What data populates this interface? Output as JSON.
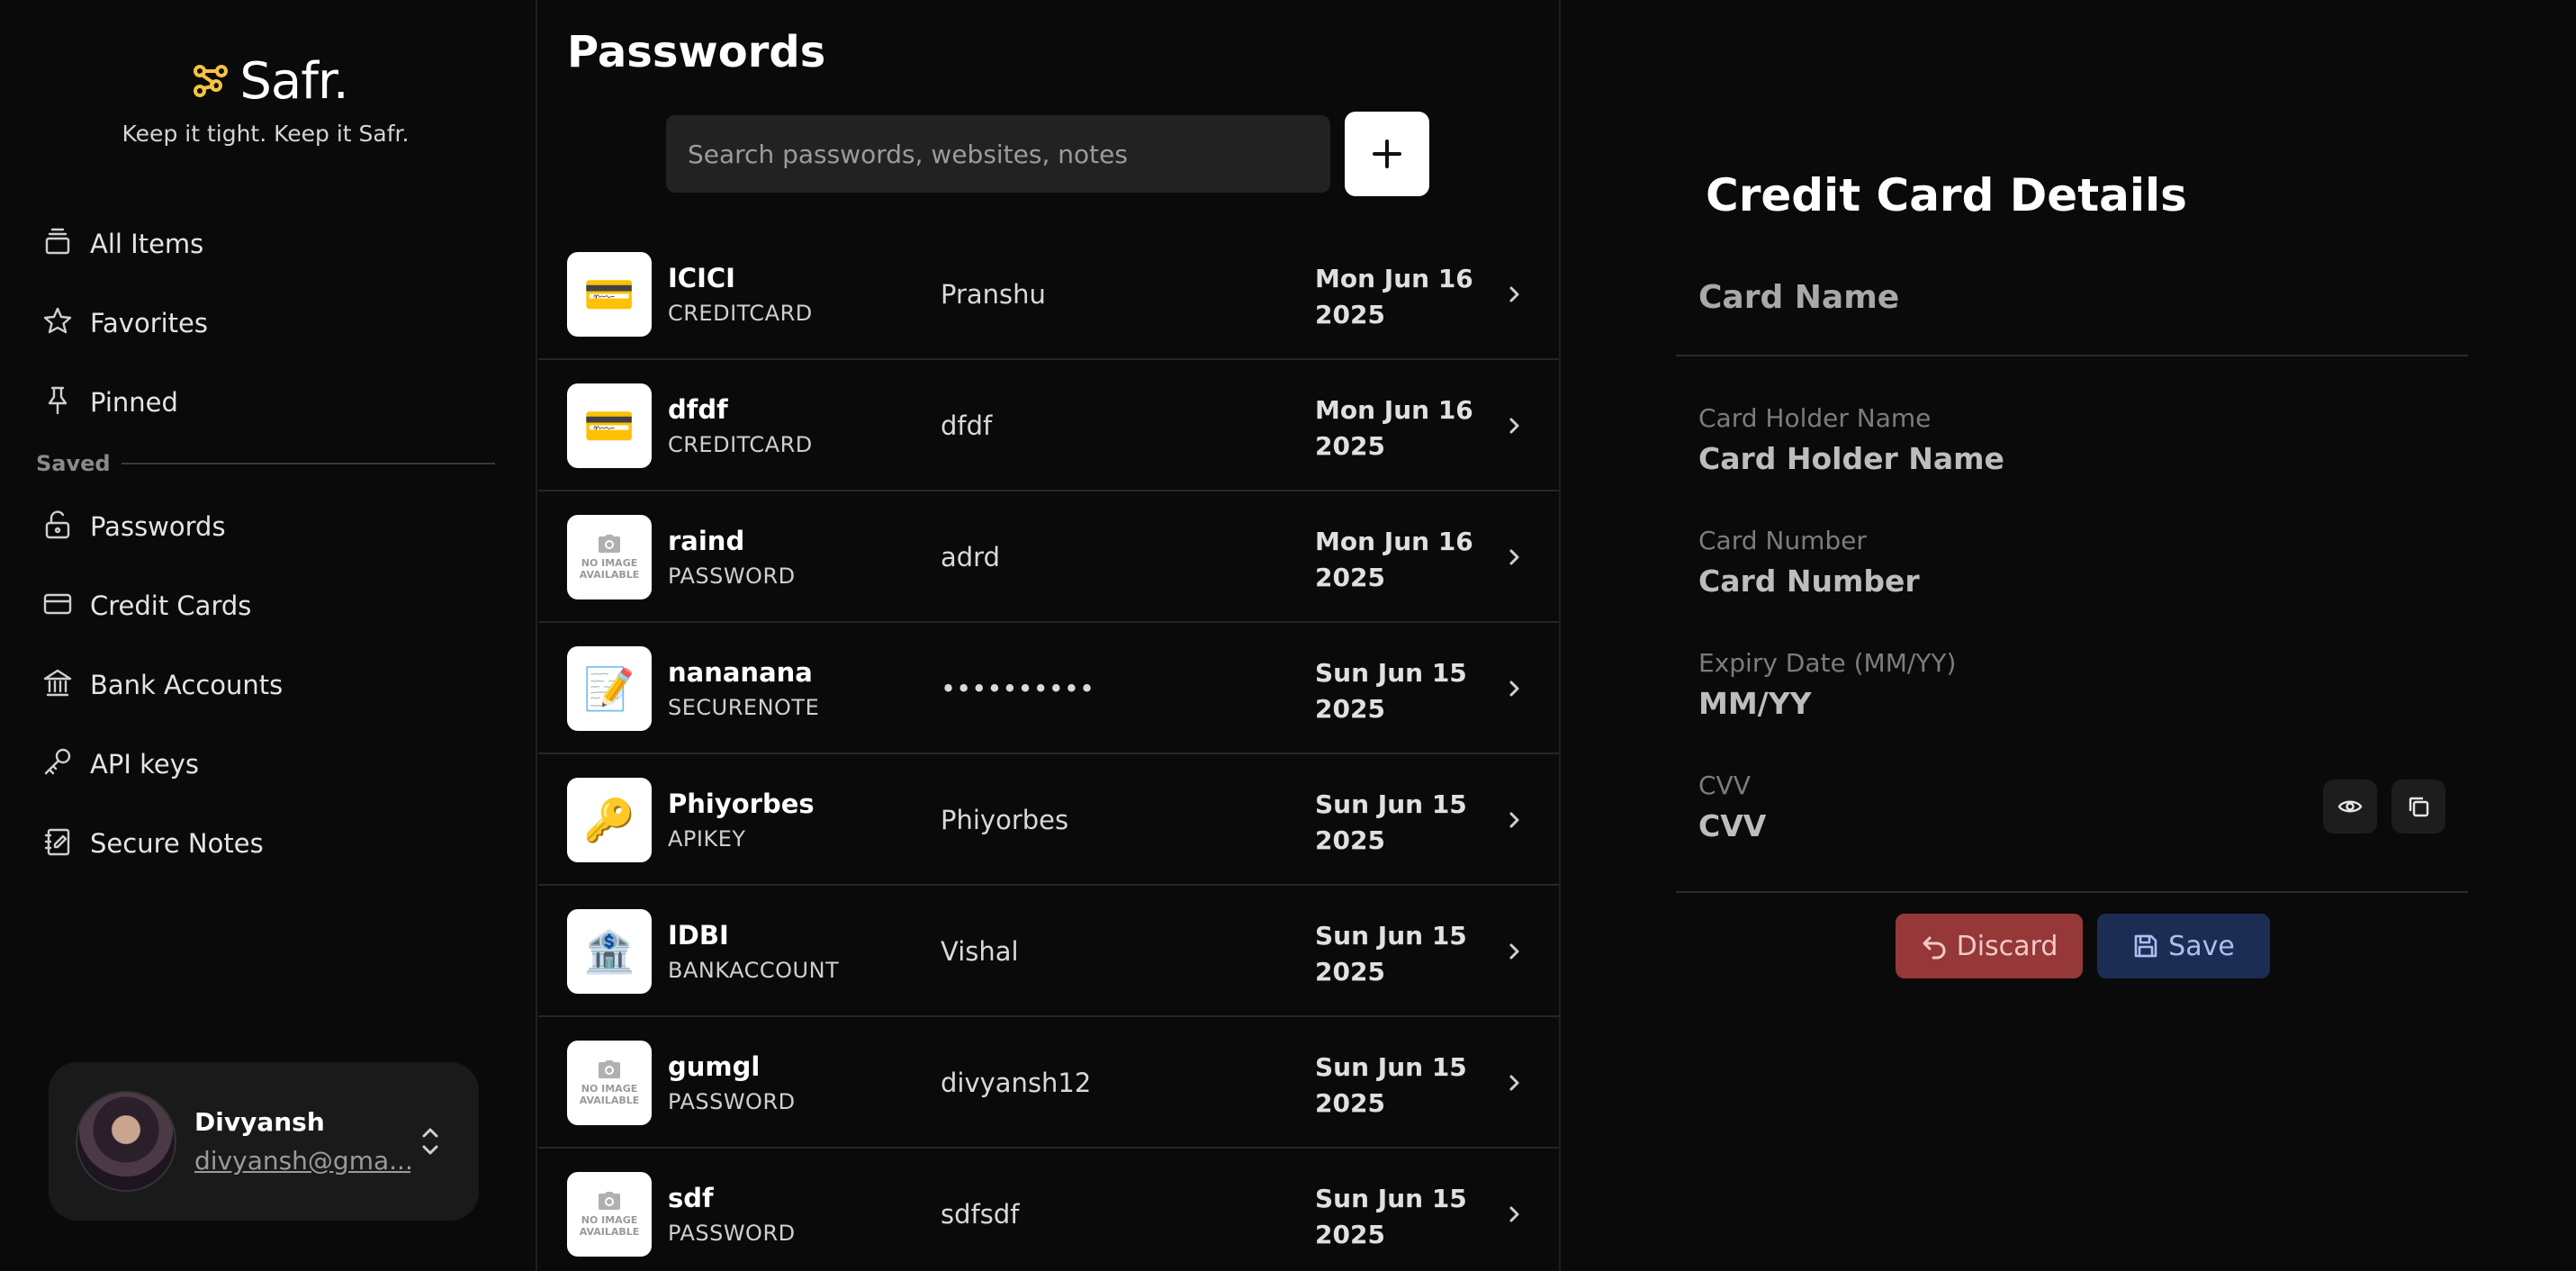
{
  "brand": {
    "name": "Safr.",
    "tagline": "Keep it tight. Keep it Safr.",
    "accent": "#f5c242"
  },
  "sidebar": {
    "items": [
      {
        "label": "All Items",
        "icon": "stack-icon"
      },
      {
        "label": "Favorites",
        "icon": "star-icon"
      },
      {
        "label": "Pinned",
        "icon": "pin-icon"
      }
    ],
    "section_label": "Saved",
    "saved_items": [
      {
        "label": "Passwords",
        "icon": "lock-open-icon"
      },
      {
        "label": "Credit Cards",
        "icon": "credit-card-icon"
      },
      {
        "label": "Bank Accounts",
        "icon": "bank-icon"
      },
      {
        "label": "API keys",
        "icon": "key-icon"
      },
      {
        "label": "Secure Notes",
        "icon": "notebook-icon"
      }
    ]
  },
  "user": {
    "name": "Divyansh",
    "email": "divyansh@gma..."
  },
  "list": {
    "title": "Passwords",
    "search_placeholder": "Search passwords, websites, notes",
    "rows": [
      {
        "name": "ICICI",
        "type": "CREDITCARD",
        "user": "Pranshu",
        "date_line1": "Mon Jun 16",
        "date_line2": "2025",
        "thumb": "💳"
      },
      {
        "name": "dfdf",
        "type": "CREDITCARD",
        "user": "dfdf",
        "date_line1": "Mon Jun 16",
        "date_line2": "2025",
        "thumb": "💳"
      },
      {
        "name": "raind",
        "type": "PASSWORD",
        "user": "adrd",
        "date_line1": "Mon Jun 16",
        "date_line2": "2025",
        "thumb": "no-image"
      },
      {
        "name": "nananana",
        "type": "SECURENOTE",
        "user": "••••••••••",
        "date_line1": "Sun Jun 15",
        "date_line2": "2025",
        "thumb": "📝"
      },
      {
        "name": "Phiyorbes",
        "type": "APIKEY",
        "user": "Phiyorbes",
        "date_line1": "Sun Jun 15",
        "date_line2": "2025",
        "thumb": "🔑"
      },
      {
        "name": "IDBI",
        "type": "BANKACCOUNT",
        "user": "Vishal",
        "date_line1": "Sun Jun 15",
        "date_line2": "2025",
        "thumb": "🏦"
      },
      {
        "name": "gumgl",
        "type": "PASSWORD",
        "user": "divyansh12",
        "date_line1": "Sun Jun 15",
        "date_line2": "2025",
        "thumb": "no-image"
      },
      {
        "name": "sdf",
        "type": "PASSWORD",
        "user": "sdfsdf",
        "date_line1": "Sun Jun 15",
        "date_line2": "2025",
        "thumb": "no-image"
      }
    ],
    "no_image_text": [
      "NO IMAGE",
      "AVAILABLE"
    ]
  },
  "details": {
    "title": "Credit Card Details",
    "card_name_placeholder": "Card Name",
    "fields": [
      {
        "label": "Card Holder Name",
        "value": "Card Holder Name"
      },
      {
        "label": "Card Number",
        "value": "Card Number"
      },
      {
        "label": "Expiry Date (MM/YY)",
        "value": "MM/YY"
      },
      {
        "label": "CVV",
        "value": "CVV"
      }
    ],
    "discard_label": "Discard",
    "save_label": "Save",
    "colors": {
      "discard": "#963838",
      "save": "#1d2c52"
    }
  }
}
